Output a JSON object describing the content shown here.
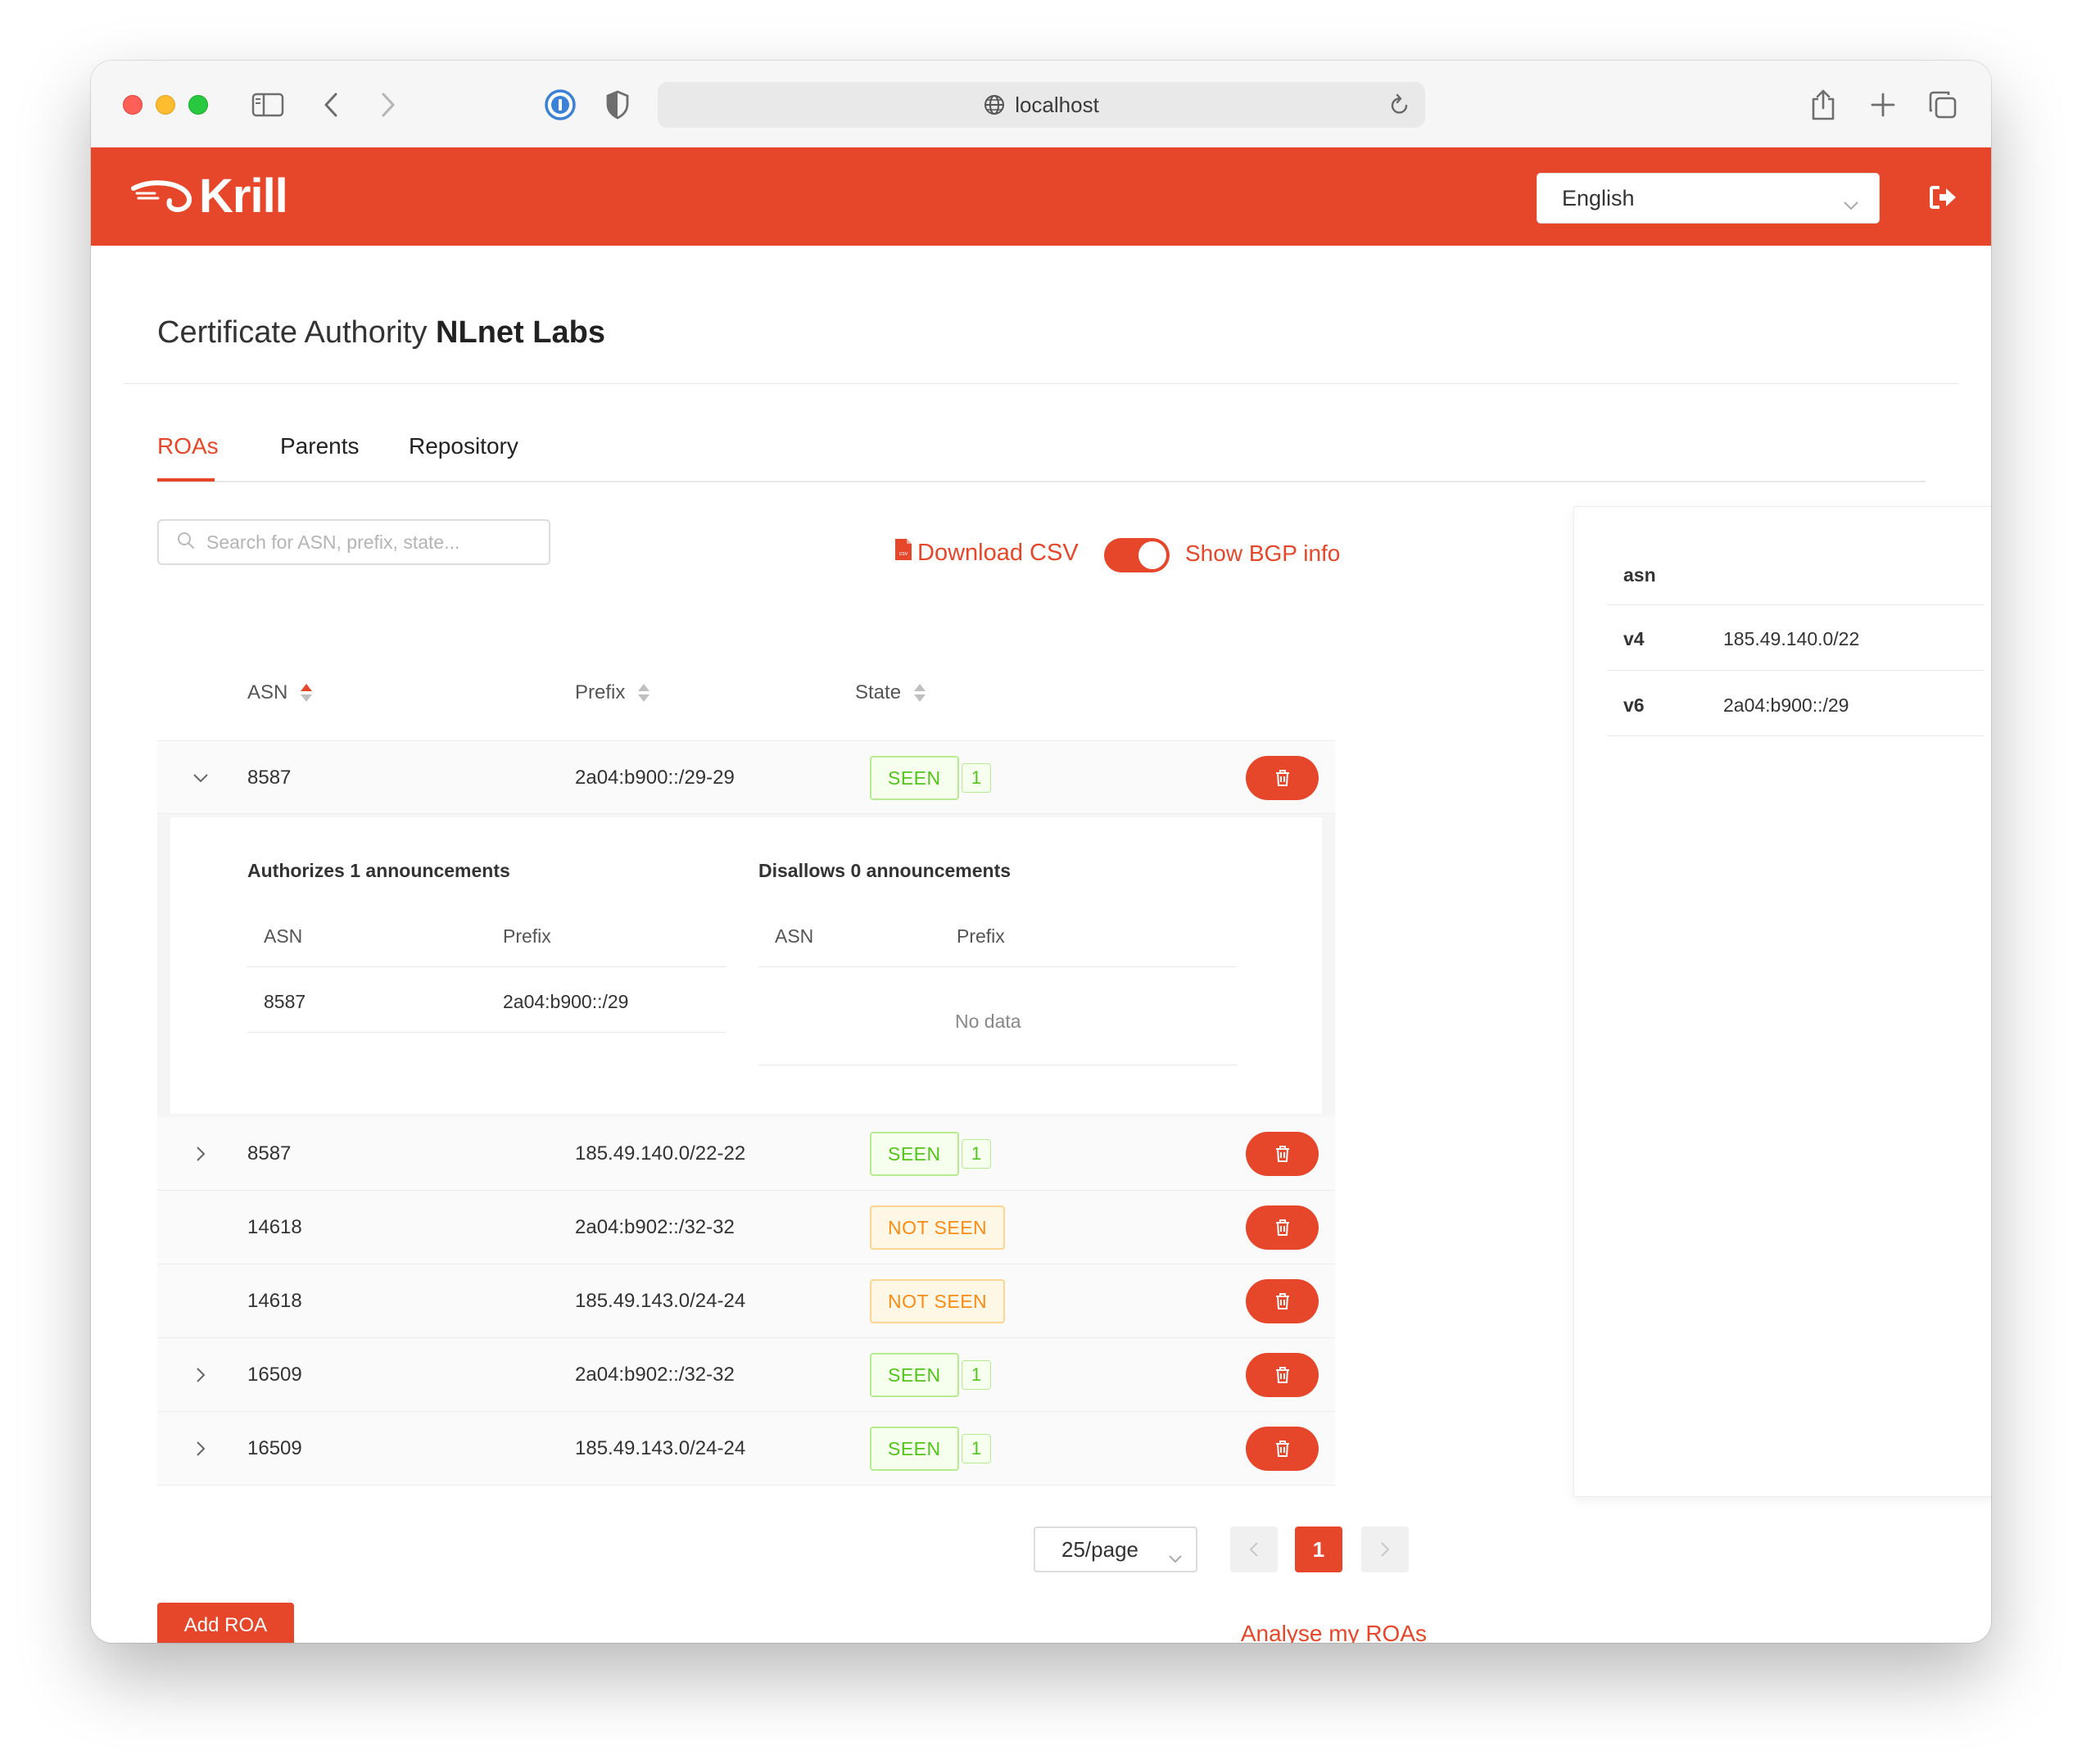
{
  "browser": {
    "address": "localhost"
  },
  "app": {
    "logo_text": "Krill",
    "language": "English"
  },
  "page": {
    "title_prefix": "Certificate Authority",
    "title_name": "NLnet Labs"
  },
  "tabs": [
    "ROAs",
    "Parents",
    "Repository"
  ],
  "toolbar": {
    "search_placeholder": "Search for ASN, prefix, state...",
    "download_csv": "Download CSV",
    "csv_badge": "csv",
    "show_bgp": "Show BGP info",
    "show_bgp_enabled": true
  },
  "table": {
    "columns": [
      "ASN",
      "Prefix",
      "State"
    ],
    "rows": [
      {
        "asn": "8587",
        "prefix": "2a04:b900::/29-29",
        "state": "SEEN",
        "count": "1",
        "expandable": true,
        "expanded": true
      },
      {
        "asn": "8587",
        "prefix": "185.49.140.0/22-22",
        "state": "SEEN",
        "count": "1",
        "expandable": true,
        "expanded": false
      },
      {
        "asn": "14618",
        "prefix": "2a04:b902::/32-32",
        "state": "NOT SEEN",
        "count": "",
        "expandable": false,
        "expanded": false
      },
      {
        "asn": "14618",
        "prefix": "185.49.143.0/24-24",
        "state": "NOT SEEN",
        "count": "",
        "expandable": false,
        "expanded": false
      },
      {
        "asn": "16509",
        "prefix": "2a04:b902::/32-32",
        "state": "SEEN",
        "count": "1",
        "expandable": true,
        "expanded": false
      },
      {
        "asn": "16509",
        "prefix": "185.49.143.0/24-24",
        "state": "SEEN",
        "count": "1",
        "expandable": true,
        "expanded": false
      }
    ]
  },
  "detail": {
    "authorizes_title": "Authorizes 1 announcements",
    "disallows_title": "Disallows 0 announcements",
    "col_asn": "ASN",
    "col_prefix": "Prefix",
    "authorizes": [
      {
        "asn": "8587",
        "prefix": "2a04:b900::/29"
      }
    ],
    "no_data": "No data"
  },
  "pagination": {
    "page_size": "25/page",
    "current_page": "1"
  },
  "actions": {
    "add_roa": "Add ROA",
    "analyse": "Analyse my ROAs"
  },
  "side_panel": {
    "header": "asn",
    "rows": [
      {
        "key": "v4",
        "value": "185.49.140.0/22"
      },
      {
        "key": "v6",
        "value": "2a04:b900::/29"
      }
    ]
  },
  "colors": {
    "brand": "#e6472a",
    "seen": "#52c41a",
    "not_seen": "#fa8c16"
  }
}
